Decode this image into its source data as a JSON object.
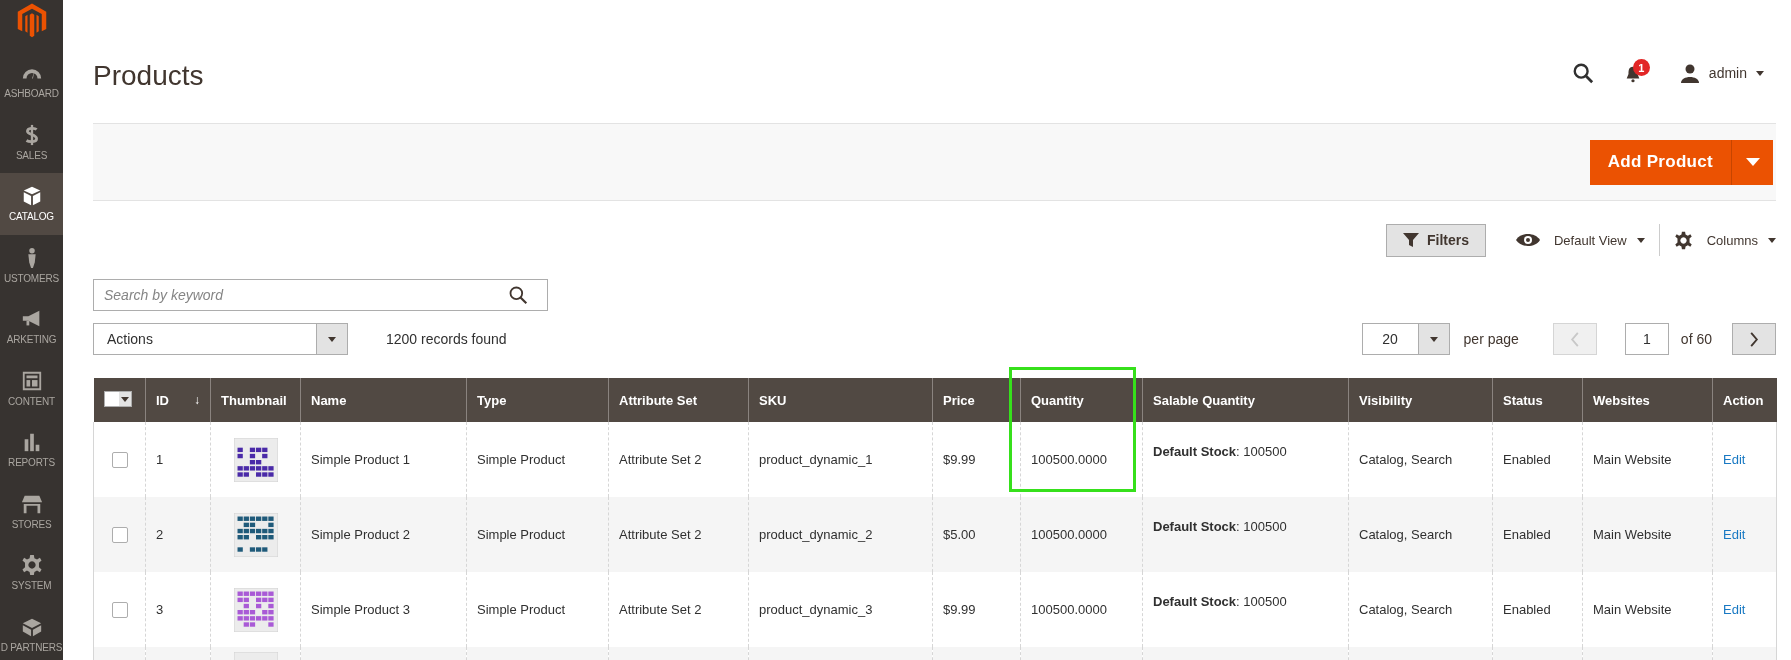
{
  "sidebar": {
    "items": [
      {
        "label": "ASHBOARD",
        "selected": false
      },
      {
        "label": "SALES",
        "selected": false
      },
      {
        "label": "CATALOG",
        "selected": true
      },
      {
        "label": "USTOMERS",
        "selected": false
      },
      {
        "label": "ARKETING",
        "selected": false
      },
      {
        "label": "CONTENT",
        "selected": false
      },
      {
        "label": "REPORTS",
        "selected": false
      },
      {
        "label": "STORES",
        "selected": false
      },
      {
        "label": "SYSTEM",
        "selected": false
      },
      {
        "label": "D PARTNERS",
        "selected": false
      }
    ]
  },
  "page": {
    "title": "Products",
    "notifications": "1",
    "user": "admin"
  },
  "primary_action": {
    "label": "Add Product"
  },
  "toolbar": {
    "filters": "Filters",
    "view": "Default View",
    "columns": "Columns"
  },
  "search": {
    "placeholder": "Search by keyword"
  },
  "actions": {
    "value": "Actions"
  },
  "records_found": "1200 records found",
  "pagination": {
    "page_size": "20",
    "per_page_label": "per page",
    "page": "1",
    "of_pages": "of 60"
  },
  "table": {
    "mass_select": {
      "checked": false
    },
    "columns": [
      {
        "label": "ID",
        "sort_indicator": "↓",
        "highlighted": false
      },
      {
        "label": "Thumbnail",
        "highlighted": false
      },
      {
        "label": "Name",
        "highlighted": false
      },
      {
        "label": "Type",
        "highlighted": false
      },
      {
        "label": "Attribute Set",
        "highlighted": false
      },
      {
        "label": "SKU",
        "highlighted": false
      },
      {
        "label": "Price",
        "highlighted": false
      },
      {
        "label": "Quantity",
        "highlighted": true
      },
      {
        "label": "Salable Quantity",
        "highlighted": false
      },
      {
        "label": "Visibility",
        "highlighted": false
      },
      {
        "label": "Status",
        "highlighted": false
      },
      {
        "label": "Websites",
        "highlighted": false
      },
      {
        "label": "Action",
        "highlighted": false
      }
    ],
    "rows": [
      {
        "checked": false,
        "id": "1",
        "thumbnail": {
          "kind": "picture"
        },
        "name": "Simple Product 1",
        "type": "Simple Product",
        "attribute_set": "Attribute Set 2",
        "sku": "product_dynamic_1",
        "price": "$9.99",
        "quantity": "100500.0000",
        "salable_quantity": "**Default Stock**: 100500",
        "visibility": "Catalog, Search",
        "status": "Enabled",
        "websites": "Main Website",
        "action": "Edit"
      },
      {
        "checked": false,
        "id": "2",
        "thumbnail": {
          "kind": "picture"
        },
        "name": "Simple Product 2",
        "type": "Simple Product",
        "attribute_set": "Attribute Set 2",
        "sku": "product_dynamic_2",
        "price": "$5.00",
        "quantity": "100500.0000",
        "salable_quantity": "**Default Stock**: 100500",
        "visibility": "Catalog, Search",
        "status": "Enabled",
        "websites": "Main Website",
        "action": "Edit"
      },
      {
        "checked": false,
        "id": "3",
        "thumbnail": {
          "kind": "picture"
        },
        "name": "Simple Product 3",
        "type": "Simple Product",
        "attribute_set": "Attribute Set 2",
        "sku": "product_dynamic_3",
        "price": "$9.99",
        "quantity": "100500.0000",
        "salable_quantity": "**Default Stock**: 100500",
        "visibility": "Catalog, Search",
        "status": "Enabled",
        "websites": "Main Website",
        "action": "Edit"
      },
      {
        "thumbnail": {
          "kind": "picture"
        }
      }
    ]
  }
}
